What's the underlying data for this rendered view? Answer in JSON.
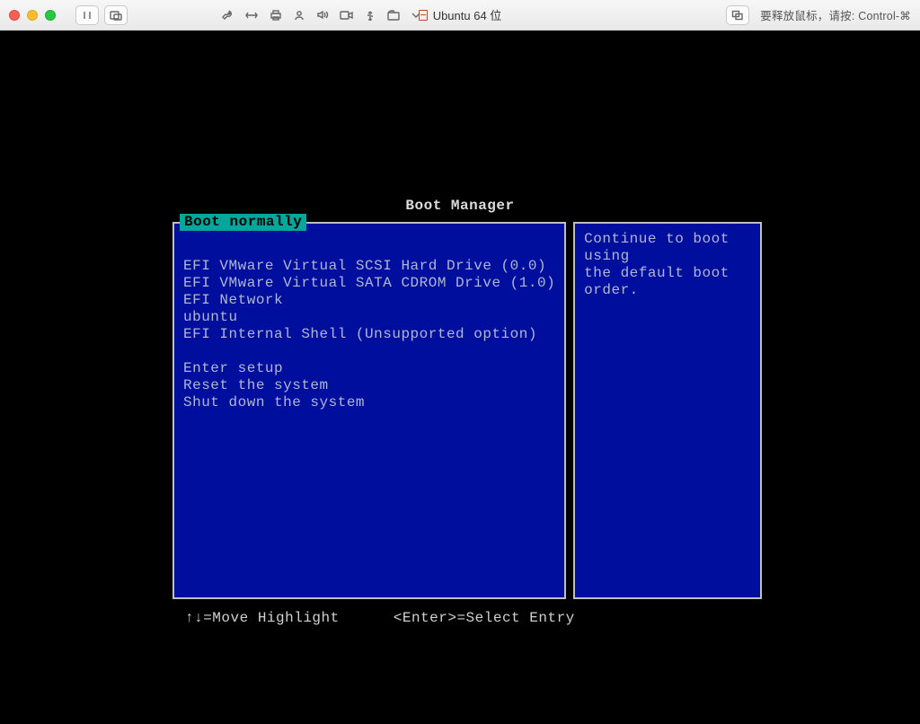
{
  "window": {
    "title": "Ubuntu 64 位",
    "release_hint": "要释放鼠标，请按: Control-⌘"
  },
  "toolbar_icons": {
    "pause": "pause-icon",
    "snapshot": "snapshot-icon",
    "wrench": "wrench-icon",
    "resize": "resize-icon",
    "printer": "printer-icon",
    "camera_user": "camera-user-icon",
    "sound": "sound-icon",
    "video": "video-icon",
    "usb": "usb-icon",
    "share": "share-icon",
    "dropdown": "chevron-down",
    "fullscreen": "fullscreen-icon"
  },
  "bios": {
    "title": "Boot Manager",
    "selected_label": "Boot normally",
    "boot_entries": [
      "EFI VMware Virtual SCSI Hard Drive (0.0)",
      "EFI VMware Virtual SATA CDROM Drive (1.0)",
      "EFI Network",
      "ubuntu",
      "EFI Internal Shell (Unsupported option)"
    ],
    "system_entries": [
      "Enter setup",
      "Reset the system",
      "Shut down the system"
    ],
    "description": [
      "Continue to boot using",
      "the default boot order."
    ],
    "footer_move": "↑↓=Move Highlight",
    "footer_select": "<Enter>=Select Entry"
  }
}
